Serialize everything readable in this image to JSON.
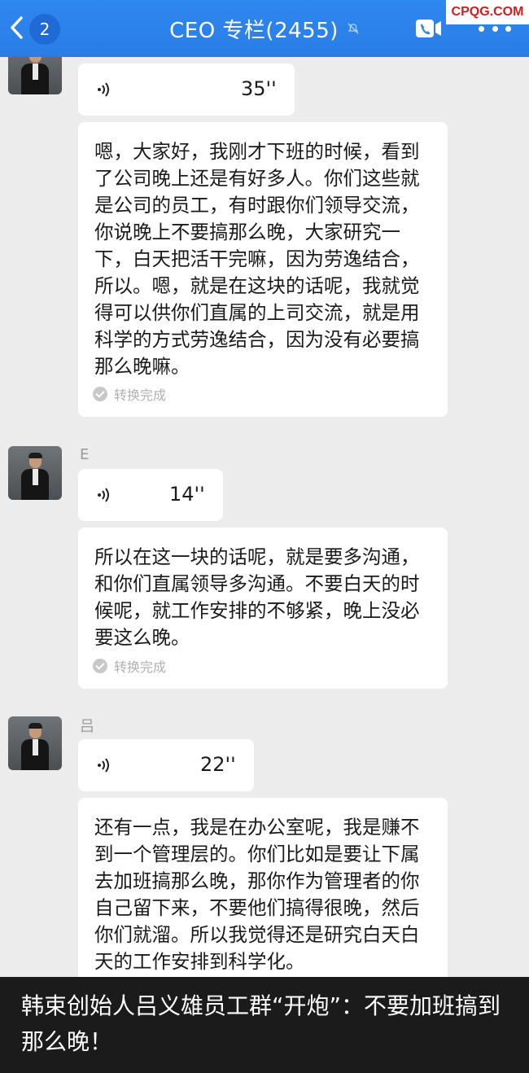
{
  "header": {
    "unread_count": "2",
    "title": "CEO 专栏(2455)"
  },
  "watermark": {
    "logo_text": "CPQG.COM"
  },
  "messages": [
    {
      "voice_duration": "35''",
      "transcript": "嗯，大家好，我刚才下班的时候，看到了公司晚上还是有好多人。你们这些就是公司的员工，有时跟你们领导交流，你说晚上不要搞那么晚，大家研究一下，白天把活干完嘛，因为劳逸结合，所以。嗯，就是在这块的话呢，我就觉得可以供你们直属的上司交流，就是用科学的方式劳逸结合，因为没有必要搞那么晚嘛。",
      "status": "转换完成"
    },
    {
      "sender": "E",
      "voice_duration": "14''",
      "transcript": "所以在这一块的话呢，就是要多沟通，和你们直属领导多沟通。不要白天的时候呢，就工作安排的不够紧，晚上没必要这么晚。",
      "status": "转换完成"
    },
    {
      "sender": "吕",
      "voice_duration": "22''",
      "transcript": "还有一点，我是在办公室呢，我是赚不到一个管理层的。你们比如是要让下属去加班搞那么晚，那你作为管理者的你自己留下来，不要他们搞得很晚，然后你们就溜。所以我觉得还是研究白天白天的工作安排到科学化。"
    }
  ],
  "caption": {
    "text": "韩束创始人吕义雄员工群“开炮”：不要加班搞到那么晚！"
  },
  "colors": {
    "header_bg": "#2f87f0",
    "chat_bg": "#ececec",
    "bubble_bg": "#ffffff",
    "caption_bg": "#1b1b1b",
    "logo_red": "#d21d1d"
  }
}
